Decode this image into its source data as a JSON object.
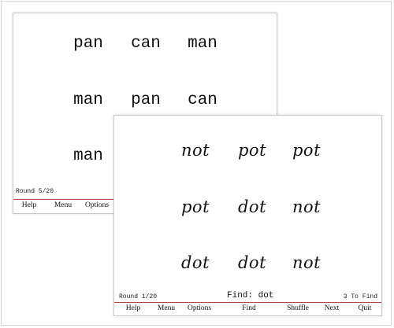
{
  "back_window": {
    "words": [
      [
        "pan",
        "can",
        "man"
      ],
      [
        "man",
        "pan",
        "can"
      ],
      [
        "man",
        "",
        ""
      ]
    ],
    "round": "Round 5/20",
    "menu": [
      "Help",
      "Menu",
      "Options"
    ]
  },
  "front_window": {
    "words": [
      [
        "not",
        "pot",
        "pot"
      ],
      [
        "pot",
        "dot",
        "not"
      ],
      [
        "dot",
        "dot",
        "not"
      ]
    ],
    "round": "Round 1/20",
    "find": "Find: dot",
    "count": "3 To Find",
    "menu": [
      "Help",
      "Menu",
      "Options",
      "Find",
      "Shuffle",
      "Next",
      "Quit"
    ]
  },
  "colors": {
    "divider": "#b04848",
    "border": "#c9c9c9"
  }
}
